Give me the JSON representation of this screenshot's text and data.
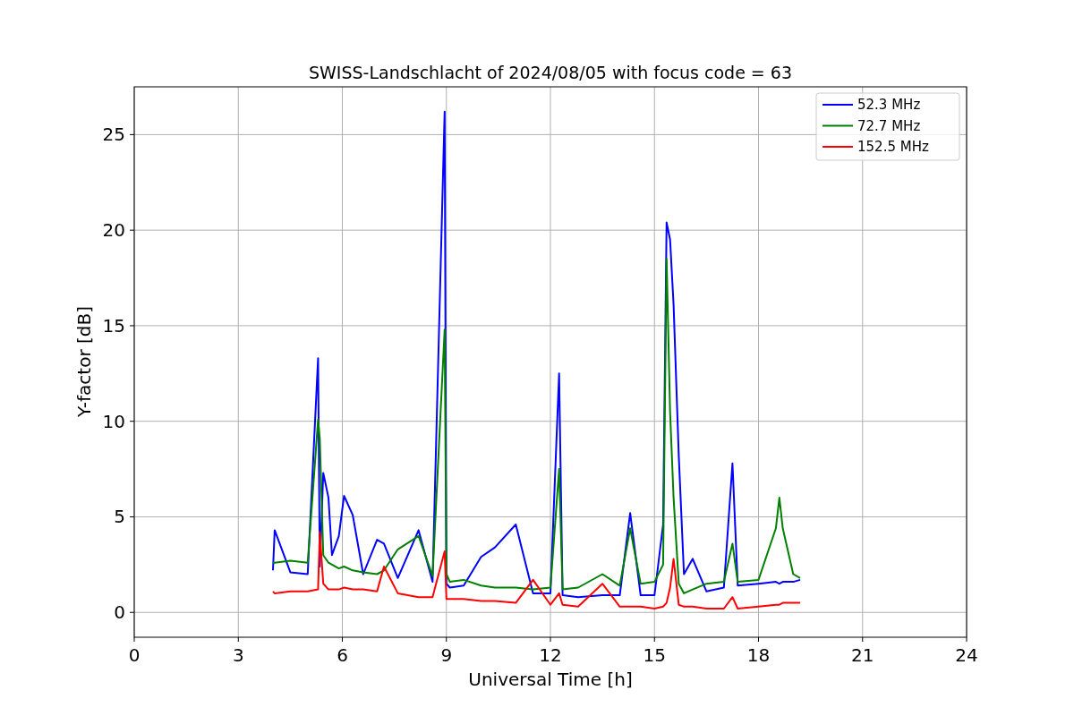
{
  "figure": {
    "chart_data": {
      "type": "line",
      "title": "SWISS-Landschlacht of 2024/08/05 with focus code = 63",
      "xlabel": "Universal Time [h]",
      "ylabel": "Y-factor [dB]",
      "x": [
        4.0,
        4.05,
        4.5,
        5.0,
        5.3,
        5.35,
        5.45,
        5.6,
        5.7,
        5.9,
        6.05,
        6.3,
        6.6,
        7.0,
        7.2,
        7.6,
        8.2,
        8.6,
        8.95,
        9.0,
        9.1,
        9.5,
        10.0,
        10.4,
        11.0,
        11.5,
        12.0,
        12.25,
        12.35,
        12.8,
        13.5,
        14.0,
        14.3,
        14.6,
        15.0,
        15.25,
        15.35,
        15.45,
        15.55,
        15.7,
        15.85,
        16.1,
        16.5,
        17.0,
        17.25,
        17.4,
        18.0,
        18.5,
        18.6,
        18.7,
        19.0,
        19.2
      ],
      "series": [
        {
          "name": "52.3 MHz",
          "color": "#0000ff",
          "values": [
            2.2,
            4.3,
            2.1,
            2.0,
            13.3,
            2.4,
            7.3,
            6.0,
            3.0,
            4.0,
            6.1,
            5.1,
            2.0,
            3.8,
            3.6,
            1.8,
            4.3,
            1.6,
            26.2,
            1.5,
            1.3,
            1.4,
            2.9,
            3.4,
            4.6,
            1.0,
            1.0,
            12.5,
            0.9,
            0.8,
            0.9,
            0.9,
            5.2,
            0.9,
            0.9,
            4.6,
            20.4,
            19.5,
            16.1,
            8.2,
            2.0,
            2.8,
            1.1,
            1.3,
            7.8,
            1.4,
            1.5,
            1.6,
            1.5,
            1.6,
            1.6,
            1.7
          ]
        },
        {
          "name": "72.7 MHz",
          "color": "#008000",
          "values": [
            2.6,
            2.6,
            2.7,
            2.6,
            10.1,
            9.1,
            3.0,
            2.6,
            2.5,
            2.3,
            2.4,
            2.2,
            2.1,
            2.0,
            2.2,
            3.3,
            4.0,
            1.9,
            14.8,
            2.0,
            1.6,
            1.7,
            1.4,
            1.3,
            1.3,
            1.2,
            1.3,
            7.5,
            1.2,
            1.3,
            2.0,
            1.4,
            4.4,
            1.5,
            1.6,
            2.5,
            18.5,
            10.5,
            6.0,
            1.5,
            1.0,
            1.2,
            1.5,
            1.6,
            3.6,
            1.6,
            1.7,
            4.4,
            6.0,
            4.4,
            2.0,
            1.8
          ]
        },
        {
          "name": "152.5 MHz",
          "color": "#ff0000",
          "values": [
            1.1,
            1.0,
            1.1,
            1.1,
            1.2,
            4.2,
            1.5,
            1.2,
            1.2,
            1.2,
            1.3,
            1.2,
            1.2,
            1.1,
            2.4,
            1.0,
            0.8,
            0.8,
            3.2,
            0.7,
            0.7,
            0.7,
            0.6,
            0.6,
            0.5,
            1.7,
            0.4,
            1.0,
            0.4,
            0.3,
            1.5,
            0.3,
            0.3,
            0.3,
            0.2,
            0.3,
            0.5,
            1.3,
            2.8,
            0.4,
            0.3,
            0.3,
            0.2,
            0.2,
            0.8,
            0.2,
            0.3,
            0.4,
            0.4,
            0.5,
            0.5,
            0.5
          ]
        }
      ],
      "xlim": [
        0,
        24
      ],
      "ylim": [
        -1.3,
        27.5
      ],
      "xticks": [
        0,
        3,
        6,
        9,
        12,
        15,
        18,
        21,
        24
      ],
      "yticks": [
        0,
        5,
        10,
        15,
        20,
        25
      ],
      "grid": true,
      "legend": "upper right"
    }
  }
}
